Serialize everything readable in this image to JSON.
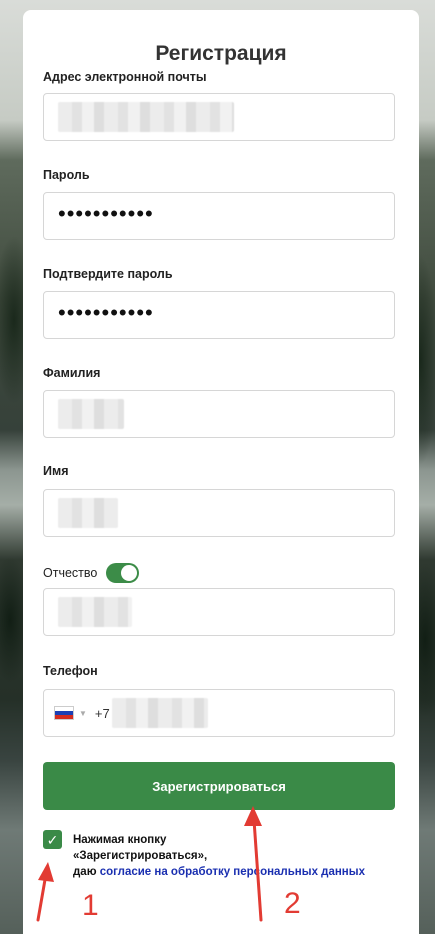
{
  "form": {
    "title": "Регистрация",
    "email_label": "Адрес электронной почты",
    "password_label": "Пароль",
    "password_value": "•••••••••••",
    "confirm_label": "Подтвердите пароль",
    "confirm_value": "•••••••••••",
    "surname_label": "Фамилия",
    "name_label": "Имя",
    "patronymic_label": "Отчество",
    "patronymic_enabled": true,
    "phone_label": "Телефон",
    "phone_prefix": "+7",
    "country_flag": "russia-flag-icon",
    "submit_label": "Зарегистрироваться",
    "consent_checked": true,
    "consent_line1": "Нажимая кнопку",
    "consent_line2": "«Зарегистрироваться»,",
    "consent_line3_prefix": "даю ",
    "consent_link": "согласие на обработку персональных данных"
  },
  "annotations": {
    "marker_1": "1",
    "marker_2": "2",
    "arrow_color": "#e23b33"
  },
  "colors": {
    "accent": "#3a8a47",
    "link": "#1a2fb0"
  }
}
